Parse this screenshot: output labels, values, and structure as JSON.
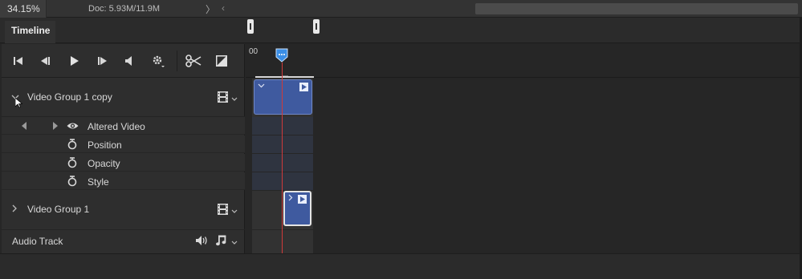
{
  "statusbar": {
    "zoom": "34.15%",
    "doc": "Doc: 5.93M/11.9M",
    "next_glyph": "〉",
    "prev_glyph": "‹"
  },
  "panel": {
    "tab_label": "Timeline"
  },
  "ruler": {
    "label": "00"
  },
  "transport": {
    "icons": [
      "go-to-first-frame-icon",
      "previous-frame-icon",
      "play-icon",
      "next-frame-icon",
      "audio-mute-icon",
      "settings-icon",
      "split-scissors-icon",
      "transition-icon"
    ]
  },
  "layers": {
    "group_copy": {
      "name": "Video Group 1 copy"
    },
    "altered_video": {
      "name": "Altered Video"
    },
    "position": {
      "name": "Position"
    },
    "opacity": {
      "name": "Opacity"
    },
    "style": {
      "name": "Style"
    },
    "group": {
      "name": "Video Group 1"
    },
    "audio": {
      "name": "Audio Track"
    }
  },
  "colors": {
    "clip_fill": "#3f5a9f",
    "playhead": "#d03a3a",
    "playhead_handle": "#3a8ee6",
    "panel_bg": "#2e2e2e"
  }
}
